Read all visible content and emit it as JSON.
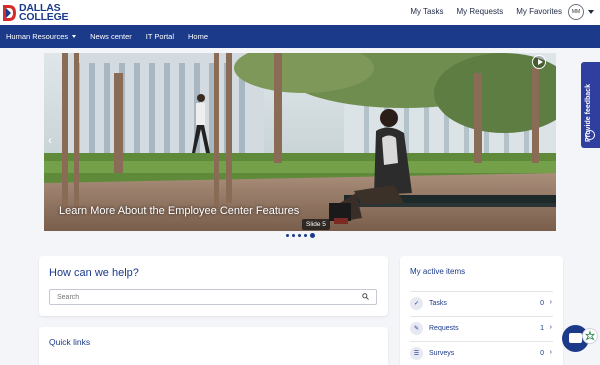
{
  "header": {
    "logo_line1": "DALLAS",
    "logo_line2": "COLLEGE",
    "links": [
      "My Tasks",
      "My Requests",
      "My Favorites"
    ],
    "avatar_initials": "MM"
  },
  "nav": {
    "items": [
      {
        "label": "Human Resources",
        "has_dropdown": true
      },
      {
        "label": "News center"
      },
      {
        "label": "IT Portal"
      },
      {
        "label": "Home"
      }
    ]
  },
  "carousel": {
    "caption": "Learn More About the Employee Center Features",
    "slide_label": "Slide 5",
    "total_slides": 5,
    "active_slide": 5
  },
  "help": {
    "title": "How can we help?",
    "search_placeholder": "Search"
  },
  "quick_links": {
    "title": "Quick links"
  },
  "active_items": {
    "title": "My active items",
    "rows": [
      {
        "label": "Tasks",
        "count": "0",
        "icon": "check-icon"
      },
      {
        "label": "Requests",
        "count": "1",
        "icon": "edit-icon"
      },
      {
        "label": "Surveys",
        "count": "0",
        "icon": "list-icon"
      }
    ]
  },
  "feedback": {
    "label": "Provide feedback"
  },
  "colors": {
    "brand_blue": "#1b3a8a",
    "brand_red": "#d62b2b",
    "feedback_purple": "#2f3fa0"
  }
}
